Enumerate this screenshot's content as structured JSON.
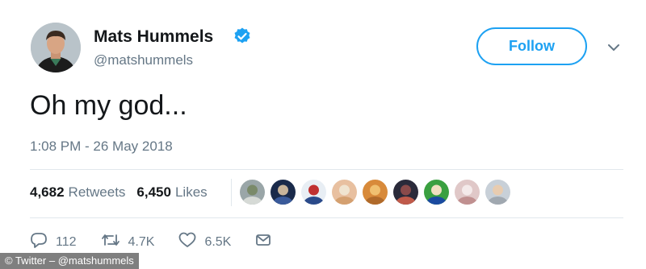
{
  "tweet": {
    "author_name": "Mats Hummels",
    "handle": "@matshummels",
    "text": "Oh my god...",
    "timestamp": "1:08 PM - 26 May 2018",
    "verified": true
  },
  "follow_button": {
    "label": "Follow"
  },
  "stats": {
    "retweets_count": "4,682",
    "retweets_label": "Retweets",
    "likes_count": "6,450",
    "likes_label": "Likes"
  },
  "likers": [
    {
      "colors": [
        "#9aa6a8",
        "#d6dad6",
        "#7a8a6a"
      ]
    },
    {
      "colors": [
        "#1a2a4a",
        "#3a5a9a",
        "#c8b49a"
      ]
    },
    {
      "colors": [
        "#e8eef4",
        "#2a4a8a",
        "#c03030"
      ]
    },
    {
      "colors": [
        "#e8c0a0",
        "#d4a070",
        "#f0e4d0"
      ]
    },
    {
      "colors": [
        "#d88a3a",
        "#b06a2a",
        "#f0c070"
      ]
    },
    {
      "colors": [
        "#2a2a3a",
        "#c05a4a",
        "#8a4a4a"
      ]
    },
    {
      "colors": [
        "#3aa040",
        "#1a4aa0",
        "#f0e0c0"
      ]
    },
    {
      "colors": [
        "#e0c8c8",
        "#c09090",
        "#f4eaea"
      ]
    },
    {
      "colors": [
        "#c8d0d8",
        "#a0a8b0",
        "#e8ccb0"
      ]
    }
  ],
  "actions": {
    "replies": "112",
    "retweets": "4.7K",
    "likes": "6.5K"
  },
  "footer": {
    "credit": "© Twitter – @matshummels"
  },
  "colors": {
    "accent": "#1da1f2",
    "secondary_text": "#657786",
    "divider": "#e1e8ed"
  }
}
